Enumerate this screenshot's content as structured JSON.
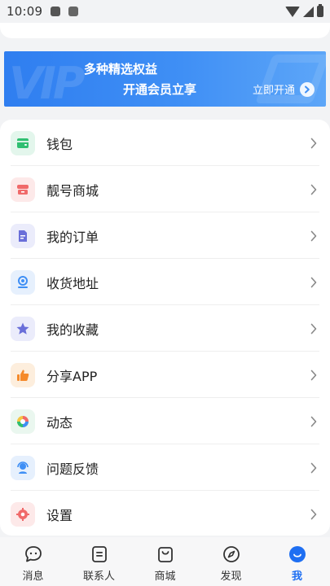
{
  "status_bar": {
    "time": "10:09"
  },
  "vip_banner": {
    "watermark": "VIP",
    "line1": "多种精选权益",
    "line2": "开通会员立享",
    "open_label": "立即开通"
  },
  "menu": {
    "items": [
      {
        "label": "钱包",
        "icon": "wallet-icon",
        "color": "#2fbf71",
        "bg": "#e3f6ec"
      },
      {
        "label": "靓号商城",
        "icon": "store-icon",
        "color": "#f06a6a",
        "bg": "#fde9e9"
      },
      {
        "label": "我的订单",
        "icon": "order-icon",
        "color": "#6a6fd9",
        "bg": "#ebecfb"
      },
      {
        "label": "收货地址",
        "icon": "location-icon",
        "color": "#3f8ff5",
        "bg": "#e6f0fd"
      },
      {
        "label": "我的收藏",
        "icon": "star-icon",
        "color": "#6a6fd9",
        "bg": "#ebecfb"
      },
      {
        "label": "分享APP",
        "icon": "thumbs-up-icon",
        "color": "#f58a2a",
        "bg": "#fdeedd"
      },
      {
        "label": "动态",
        "icon": "aperture-icon",
        "color": "#f06a6a",
        "bg": "#eaf7ef"
      },
      {
        "label": "问题反馈",
        "icon": "support-icon",
        "color": "#3f8ff5",
        "bg": "#e6f0fd"
      },
      {
        "label": "设置",
        "icon": "gear-icon",
        "color": "#f06a6a",
        "bg": "#fde9e9"
      }
    ]
  },
  "bottom_nav": {
    "items": [
      {
        "label": "消息",
        "icon": "chat-bubble-icon",
        "active": false
      },
      {
        "label": "联系人",
        "icon": "contacts-icon",
        "active": false
      },
      {
        "label": "商城",
        "icon": "shopping-bag-icon",
        "active": false
      },
      {
        "label": "发现",
        "icon": "compass-icon",
        "active": false
      },
      {
        "label": "我",
        "icon": "profile-icon",
        "active": true
      }
    ],
    "active_color": "#1f6ff2"
  }
}
